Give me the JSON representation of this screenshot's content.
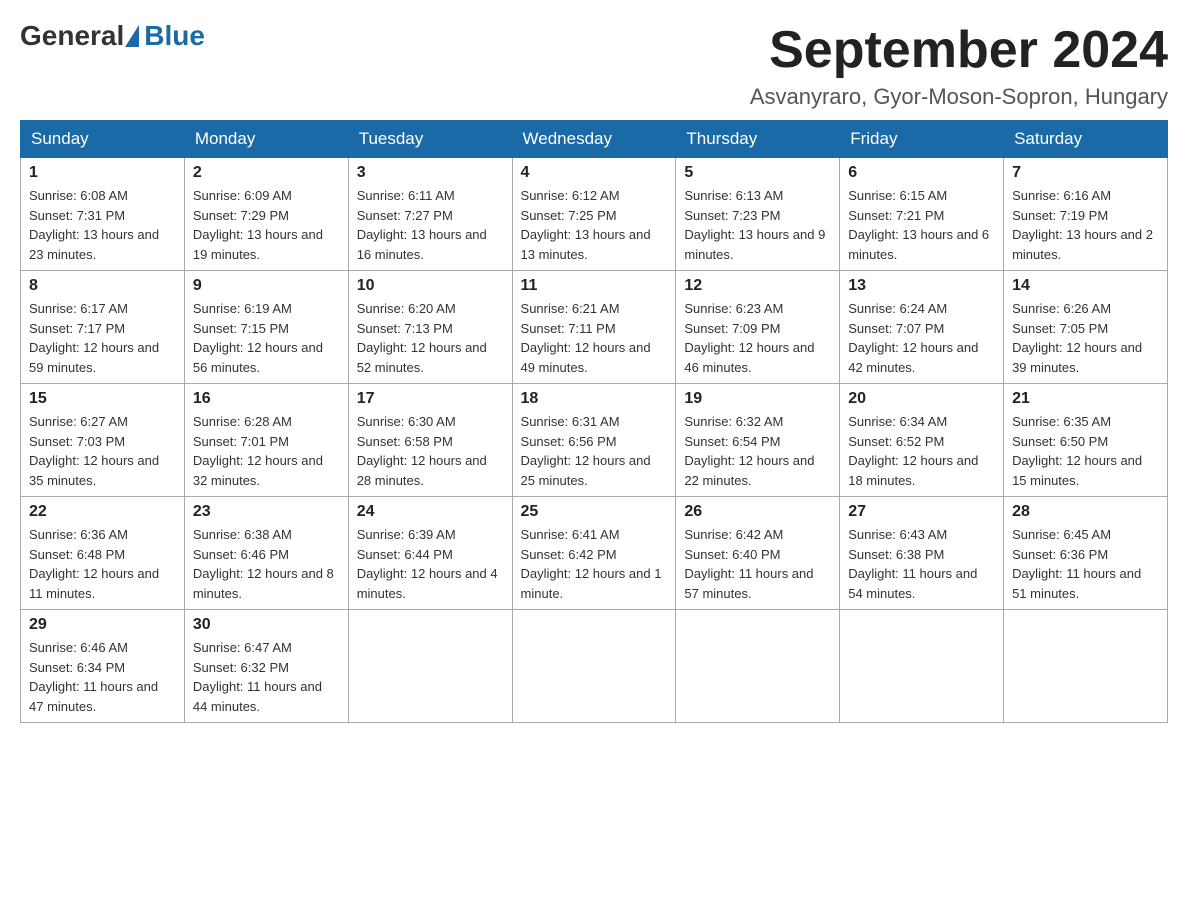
{
  "logo": {
    "general": "General",
    "blue": "Blue"
  },
  "title": "September 2024",
  "subtitle": "Asvanyraro, Gyor-Moson-Sopron, Hungary",
  "weekdays": [
    "Sunday",
    "Monday",
    "Tuesday",
    "Wednesday",
    "Thursday",
    "Friday",
    "Saturday"
  ],
  "weeks": [
    [
      {
        "day": "1",
        "sunrise": "Sunrise: 6:08 AM",
        "sunset": "Sunset: 7:31 PM",
        "daylight": "Daylight: 13 hours and 23 minutes."
      },
      {
        "day": "2",
        "sunrise": "Sunrise: 6:09 AM",
        "sunset": "Sunset: 7:29 PM",
        "daylight": "Daylight: 13 hours and 19 minutes."
      },
      {
        "day": "3",
        "sunrise": "Sunrise: 6:11 AM",
        "sunset": "Sunset: 7:27 PM",
        "daylight": "Daylight: 13 hours and 16 minutes."
      },
      {
        "day": "4",
        "sunrise": "Sunrise: 6:12 AM",
        "sunset": "Sunset: 7:25 PM",
        "daylight": "Daylight: 13 hours and 13 minutes."
      },
      {
        "day": "5",
        "sunrise": "Sunrise: 6:13 AM",
        "sunset": "Sunset: 7:23 PM",
        "daylight": "Daylight: 13 hours and 9 minutes."
      },
      {
        "day": "6",
        "sunrise": "Sunrise: 6:15 AM",
        "sunset": "Sunset: 7:21 PM",
        "daylight": "Daylight: 13 hours and 6 minutes."
      },
      {
        "day": "7",
        "sunrise": "Sunrise: 6:16 AM",
        "sunset": "Sunset: 7:19 PM",
        "daylight": "Daylight: 13 hours and 2 minutes."
      }
    ],
    [
      {
        "day": "8",
        "sunrise": "Sunrise: 6:17 AM",
        "sunset": "Sunset: 7:17 PM",
        "daylight": "Daylight: 12 hours and 59 minutes."
      },
      {
        "day": "9",
        "sunrise": "Sunrise: 6:19 AM",
        "sunset": "Sunset: 7:15 PM",
        "daylight": "Daylight: 12 hours and 56 minutes."
      },
      {
        "day": "10",
        "sunrise": "Sunrise: 6:20 AM",
        "sunset": "Sunset: 7:13 PM",
        "daylight": "Daylight: 12 hours and 52 minutes."
      },
      {
        "day": "11",
        "sunrise": "Sunrise: 6:21 AM",
        "sunset": "Sunset: 7:11 PM",
        "daylight": "Daylight: 12 hours and 49 minutes."
      },
      {
        "day": "12",
        "sunrise": "Sunrise: 6:23 AM",
        "sunset": "Sunset: 7:09 PM",
        "daylight": "Daylight: 12 hours and 46 minutes."
      },
      {
        "day": "13",
        "sunrise": "Sunrise: 6:24 AM",
        "sunset": "Sunset: 7:07 PM",
        "daylight": "Daylight: 12 hours and 42 minutes."
      },
      {
        "day": "14",
        "sunrise": "Sunrise: 6:26 AM",
        "sunset": "Sunset: 7:05 PM",
        "daylight": "Daylight: 12 hours and 39 minutes."
      }
    ],
    [
      {
        "day": "15",
        "sunrise": "Sunrise: 6:27 AM",
        "sunset": "Sunset: 7:03 PM",
        "daylight": "Daylight: 12 hours and 35 minutes."
      },
      {
        "day": "16",
        "sunrise": "Sunrise: 6:28 AM",
        "sunset": "Sunset: 7:01 PM",
        "daylight": "Daylight: 12 hours and 32 minutes."
      },
      {
        "day": "17",
        "sunrise": "Sunrise: 6:30 AM",
        "sunset": "Sunset: 6:58 PM",
        "daylight": "Daylight: 12 hours and 28 minutes."
      },
      {
        "day": "18",
        "sunrise": "Sunrise: 6:31 AM",
        "sunset": "Sunset: 6:56 PM",
        "daylight": "Daylight: 12 hours and 25 minutes."
      },
      {
        "day": "19",
        "sunrise": "Sunrise: 6:32 AM",
        "sunset": "Sunset: 6:54 PM",
        "daylight": "Daylight: 12 hours and 22 minutes."
      },
      {
        "day": "20",
        "sunrise": "Sunrise: 6:34 AM",
        "sunset": "Sunset: 6:52 PM",
        "daylight": "Daylight: 12 hours and 18 minutes."
      },
      {
        "day": "21",
        "sunrise": "Sunrise: 6:35 AM",
        "sunset": "Sunset: 6:50 PM",
        "daylight": "Daylight: 12 hours and 15 minutes."
      }
    ],
    [
      {
        "day": "22",
        "sunrise": "Sunrise: 6:36 AM",
        "sunset": "Sunset: 6:48 PM",
        "daylight": "Daylight: 12 hours and 11 minutes."
      },
      {
        "day": "23",
        "sunrise": "Sunrise: 6:38 AM",
        "sunset": "Sunset: 6:46 PM",
        "daylight": "Daylight: 12 hours and 8 minutes."
      },
      {
        "day": "24",
        "sunrise": "Sunrise: 6:39 AM",
        "sunset": "Sunset: 6:44 PM",
        "daylight": "Daylight: 12 hours and 4 minutes."
      },
      {
        "day": "25",
        "sunrise": "Sunrise: 6:41 AM",
        "sunset": "Sunset: 6:42 PM",
        "daylight": "Daylight: 12 hours and 1 minute."
      },
      {
        "day": "26",
        "sunrise": "Sunrise: 6:42 AM",
        "sunset": "Sunset: 6:40 PM",
        "daylight": "Daylight: 11 hours and 57 minutes."
      },
      {
        "day": "27",
        "sunrise": "Sunrise: 6:43 AM",
        "sunset": "Sunset: 6:38 PM",
        "daylight": "Daylight: 11 hours and 54 minutes."
      },
      {
        "day": "28",
        "sunrise": "Sunrise: 6:45 AM",
        "sunset": "Sunset: 6:36 PM",
        "daylight": "Daylight: 11 hours and 51 minutes."
      }
    ],
    [
      {
        "day": "29",
        "sunrise": "Sunrise: 6:46 AM",
        "sunset": "Sunset: 6:34 PM",
        "daylight": "Daylight: 11 hours and 47 minutes."
      },
      {
        "day": "30",
        "sunrise": "Sunrise: 6:47 AM",
        "sunset": "Sunset: 6:32 PM",
        "daylight": "Daylight: 11 hours and 44 minutes."
      },
      null,
      null,
      null,
      null,
      null
    ]
  ]
}
